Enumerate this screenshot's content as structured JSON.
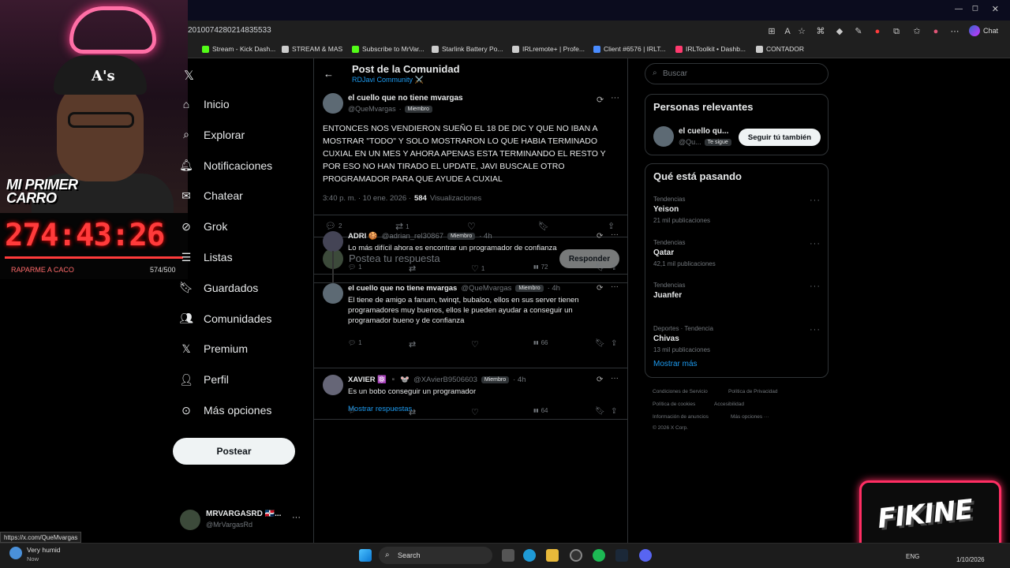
{
  "browser": {
    "url": "2010074280214835533",
    "bookmarks": [
      {
        "label": "Stream - Kick Dash...",
        "color": "#53fc18"
      },
      {
        "label": "STREAM & MAS",
        "color": "#cccccc"
      },
      {
        "label": "Subscribe to MrVar...",
        "color": "#53fc18"
      },
      {
        "label": "Starlink Battery Po...",
        "color": "#cccccc"
      },
      {
        "label": "IRLremote+ | Profe...",
        "color": "#cccccc"
      },
      {
        "label": "Client #6576 | IRLT...",
        "color": "#4a8cff"
      },
      {
        "label": "IRLToolkit • Dashb...",
        "color": "#ff3a6e"
      },
      {
        "label": "CONTADOR",
        "color": "#cccccc"
      }
    ],
    "chat_label": "Chat"
  },
  "overlay": {
    "cap_logo": "A's",
    "car_title_line1": "MI PRIMER",
    "car_title_line2": "CARRO",
    "timer": "274:43:26",
    "progress_label": "RAPARME A CACO",
    "progress_count": "574/500",
    "progress_fraction": 1.0,
    "logo_text": "FIKINE"
  },
  "nav": {
    "items": [
      {
        "label": "Inicio",
        "icon": "home-icon"
      },
      {
        "label": "Explorar",
        "icon": "search-icon"
      },
      {
        "label": "Notificaciones",
        "icon": "bell-icon"
      },
      {
        "label": "Chatear",
        "icon": "mail-icon"
      },
      {
        "label": "Grok",
        "icon": "grok-icon"
      },
      {
        "label": "Listas",
        "icon": "list-icon"
      },
      {
        "label": "Guardados",
        "icon": "bookmark-icon"
      },
      {
        "label": "Comunidades",
        "icon": "people-icon"
      },
      {
        "label": "Premium",
        "icon": "x-icon"
      },
      {
        "label": "Perfil",
        "icon": "person-icon"
      },
      {
        "label": "Más opciones",
        "icon": "more-icon"
      }
    ],
    "post_button": "Postear",
    "account_name": "MRVARGASRD 🇩🇴...",
    "account_handle": "@MrVargasRd"
  },
  "post": {
    "header_title": "Post de la Comunidad",
    "community": "RDJavi Community ⚔️",
    "author_name": "el cuello que no tiene mvargas",
    "author_handle": "@QueMvargas",
    "member_badge": "Miembro",
    "text": "ENTONCES NOS VENDIERON SUEÑO EL 18 DE DIC Y QUE NO IBAN A MOSTRAR \"TODO\" Y SOLO MOSTRARON LO QUE HABIA TERMINADO CUXIAL EN UN MES Y AHORA APENAS ESTA TERMINANDO EL RESTO Y POR ESO NO HAN TIRADO EL UPDATE, JAVI BUSCALE OTRO PROGRAMADOR PARA QUE AYUDE A CUXIAL",
    "timestamp": "3:40 p. m. · 10 ene. 2026 ·",
    "views_count": "584",
    "views_label": "Visualizaciones",
    "replies": "2",
    "reposts": "1",
    "reply_placeholder": "Postea tu respuesta",
    "reply_button": "Responder"
  },
  "replies": [
    {
      "name": "ADRI 🍪",
      "handle": "@adrian_rel30867",
      "badge": "Miembro",
      "time": "· 4h",
      "text": "Lo más difícil ahora es encontrar un programador de confianza",
      "replies": "1",
      "likes": "1",
      "views": "72"
    },
    {
      "name": "el cuello que no tiene mvargas",
      "handle": "@QueMvargas",
      "badge": "Miembro",
      "time": "· 4h",
      "text": "El tiene de amigo a fanum, twinqt, bubaloo, ellos en sus server tienen programadores muy buenos, ellos le pueden ayudar a conseguir un programador bueno y de confianza",
      "replies": "1",
      "likes": "",
      "views": "66",
      "show_replies": "Mostrar respuestas"
    },
    {
      "name": "XAVIER ⚛️ ▪️ 🐭",
      "handle": "@XAvierB9506603",
      "badge": "Miembro",
      "time": "· 4h",
      "text": "Es un bobo conseguir un programador",
      "replies": "",
      "likes": "",
      "views": "64"
    }
  ],
  "sidebar": {
    "search_placeholder": "Buscar",
    "relevant_title": "Personas relevantes",
    "relevant_name": "el cuello qu...",
    "relevant_handle": "@Qu...",
    "follows_you": "Te sigue",
    "follow_back": "Seguir tú también",
    "trending_title": "Qué está pasando",
    "trends": [
      {
        "category": "Tendencias",
        "name": "Yeison",
        "count": "21 mil publicaciones"
      },
      {
        "category": "Tendencias",
        "name": "Qatar",
        "count": "42,1 mil publicaciones"
      },
      {
        "category": "Tendencias",
        "name": "Juanfer",
        "count": ""
      },
      {
        "category": "Deportes · Tendencia",
        "name": "Chivas",
        "count": "13 mil publicaciones"
      }
    ],
    "show_more": "Mostrar más",
    "footer_links": [
      "Condiciones de Servicio",
      "Política de Privacidad",
      "Política de cookies",
      "Accesibilidad",
      "Información de anuncios",
      "Más opciones ···"
    ],
    "copyright": "© 2026 X Corp."
  },
  "statusbar": {
    "url": "https://x.com/QueMvargas"
  },
  "taskbar": {
    "weather_title": "Very humid",
    "weather_sub": "Now",
    "search": "Search",
    "lang": "ENG",
    "date": "1/10/2026"
  },
  "colors": {
    "accent": "#1d9bf0",
    "timer": "#ff3b3b",
    "logo_border": "#ff2e63"
  }
}
